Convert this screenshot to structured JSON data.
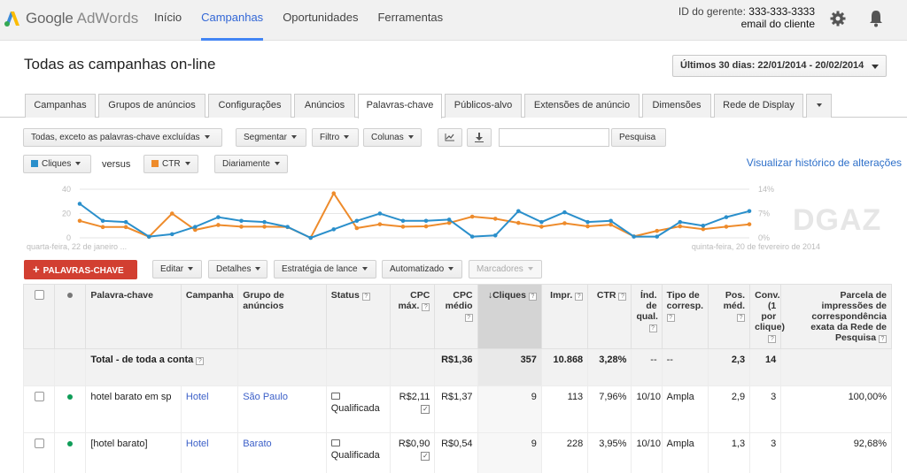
{
  "header": {
    "logo_google": "Google",
    "logo_product": "AdWords",
    "nav": [
      "Início",
      "Campanhas",
      "Oportunidades",
      "Ferramentas"
    ],
    "active_nav": "Campanhas",
    "account_label": "ID do gerente:",
    "account_id": "333-333-3333",
    "account_email": "email do cliente",
    "icons": [
      "settings-gear-icon",
      "notifications-bell-icon"
    ]
  },
  "page": {
    "title": "Todas as campanhas on-line",
    "date_range": "Últimos 30 dias: 22/01/2014 - 20/02/2014"
  },
  "tabs": [
    "Campanhas",
    "Grupos de anúncios",
    "Configurações",
    "Anúncios",
    "Palavras-chave",
    "Públicos-alvo",
    "Extensões de anúncio",
    "Dimensões",
    "Rede de Display"
  ],
  "active_tab": "Palavras-chave",
  "toolbar": {
    "filter_label": "Todas, exceto as palavras-chave excluídas",
    "segment_label": "Segmentar",
    "filter2_label": "Filtro",
    "columns_label": "Colunas",
    "search_value": "",
    "search_button": "Pesquisa"
  },
  "chart_controls": {
    "metric1": "Cliques",
    "metric1_color": "#2a8fcb",
    "versus": "versus",
    "metric2": "CTR",
    "metric2_color": "#ee8b2b",
    "interval": "Diariamente",
    "history_link": "Visualizar histórico de alterações"
  },
  "chart_data": {
    "type": "line",
    "x_start_label": "quarta-feira, 22 de janeiro ...",
    "x_end_label": "quinta-feira, 20 de fevereiro de 2014",
    "left_ticks": [
      "40",
      "20",
      "0"
    ],
    "right_ticks": [
      "14%",
      "7%",
      "0%"
    ],
    "ylim_left": [
      0,
      40
    ],
    "ylim_right": [
      0,
      14
    ],
    "grid": true,
    "series": [
      {
        "name": "Cliques",
        "axis": "left",
        "values": [
          28,
          14,
          13,
          1,
          3,
          9,
          17,
          14,
          13,
          9,
          0,
          7,
          14,
          20,
          14,
          14,
          15,
          1,
          2,
          22,
          13,
          21,
          13,
          14,
          1,
          1,
          13,
          10,
          17,
          22
        ]
      },
      {
        "name": "CTR",
        "axis": "right",
        "values": [
          4.9,
          3.1,
          3.1,
          0.3,
          7.0,
          2.3,
          3.7,
          3.2,
          3.2,
          3.1,
          0,
          12.8,
          2.8,
          3.9,
          3.2,
          3.3,
          4.3,
          6.1,
          5.5,
          4.3,
          3.2,
          4.2,
          3.3,
          3.8,
          0.4,
          2.0,
          3.3,
          2.5,
          3.2,
          3.9
        ]
      }
    ]
  },
  "watermark": "DGAZ",
  "actions": {
    "add_button": "PALAVRAS-CHAVE",
    "edit": "Editar",
    "details": "Detalhes",
    "bid_strategy": "Estratégia de lance",
    "automated": "Automatizado",
    "labels": "Marcadores"
  },
  "table": {
    "headers": {
      "keyword": "Palavra-chave",
      "campaign": "Campanha",
      "adgroup": "Grupo de anúncios",
      "status": "Status",
      "maxcpc": "CPC máx.",
      "avgcpc": "CPC médio",
      "clicks": "Cliques",
      "impr": "Impr.",
      "ctr": "CTR",
      "qs": "Índ. de qual.",
      "match": "Tipo de corresp.",
      "pos": "Pos. méd.",
      "conv": "Conv. (1 por clique)",
      "share": "Parcela de impressões de correspondência exata da Rede de Pesquisa"
    },
    "total": {
      "label": "Total - de toda a conta",
      "avgcpc": "R$1,36",
      "clicks": "357",
      "impr": "10.868",
      "ctr": "3,28%",
      "qs": "--",
      "match": "--",
      "pos": "2,3",
      "conv": "14"
    },
    "rows": [
      {
        "keyword": "hotel barato em sp",
        "campaign": "Hotel",
        "adgroup": "São Paulo",
        "status": "Qualificada",
        "maxcpc": "R$2,11",
        "avgcpc": "R$1,37",
        "clicks": "9",
        "impr": "113",
        "ctr": "7,96%",
        "qs": "10/10",
        "match": "Ampla",
        "pos": "2,9",
        "conv": "3",
        "share": "100,00%"
      },
      {
        "keyword": "[hotel barato]",
        "campaign": "Hotel",
        "adgroup": "Barato",
        "status": "Qualificada",
        "maxcpc": "R$0,90",
        "avgcpc": "R$0,54",
        "clicks": "9",
        "impr": "228",
        "ctr": "3,95%",
        "qs": "10/10",
        "match": "Ampla",
        "pos": "1,3",
        "conv": "3",
        "share": "92,68%"
      }
    ]
  }
}
